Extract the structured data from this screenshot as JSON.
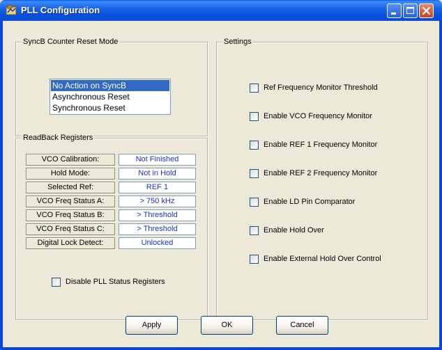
{
  "window": {
    "title": "PLL Configuration"
  },
  "sync_group": {
    "title": "SyncB Counter Reset Mode",
    "options": [
      "No Action on SyncB",
      "Asynchronous Reset",
      "Synchronous Reset"
    ],
    "selected": "No Action on SyncB"
  },
  "readback": {
    "title": "ReadBack Registers",
    "rows": [
      {
        "label": "VCO Calibration:",
        "value": "Not Finished"
      },
      {
        "label": "Hold Mode:",
        "value": "Not in Hold"
      },
      {
        "label": "Selected Ref:",
        "value": "REF 1"
      },
      {
        "label": "VCO Freq Status A:",
        "value": "> 750 kHz"
      },
      {
        "label": "VCO Freq Status B:",
        "value": "> Threshold"
      },
      {
        "label": "VCO Freq Status C:",
        "value": "> Threshold"
      },
      {
        "label": "Digital Lock Detect:",
        "value": "Unlocked"
      }
    ],
    "disable_label": "Disable PLL Status Registers",
    "disable_checked": false
  },
  "settings": {
    "title": "Settings",
    "checkboxes": [
      {
        "label": "Ref Frequency Monitor Threshold",
        "checked": false
      },
      {
        "label": "Enable VCO Frequency Monitor",
        "checked": false
      },
      {
        "label": "Enable REF 1 Frequency Monitor",
        "checked": false
      },
      {
        "label": "Enable REF 2 Frequency Monitor",
        "checked": false
      },
      {
        "label": "Enable LD Pin Comparator",
        "checked": false
      },
      {
        "label": "Enable Hold Over",
        "checked": false
      },
      {
        "label": "Enable External Hold Over Control",
        "checked": false
      }
    ]
  },
  "buttons": {
    "apply": "Apply",
    "ok": "OK",
    "cancel": "Cancel"
  },
  "colors": {
    "titlebar": "#0a58e8",
    "selection": "#316ac5",
    "value_text": "#1c2fd0",
    "dialog_bg": "#ece9d8"
  }
}
